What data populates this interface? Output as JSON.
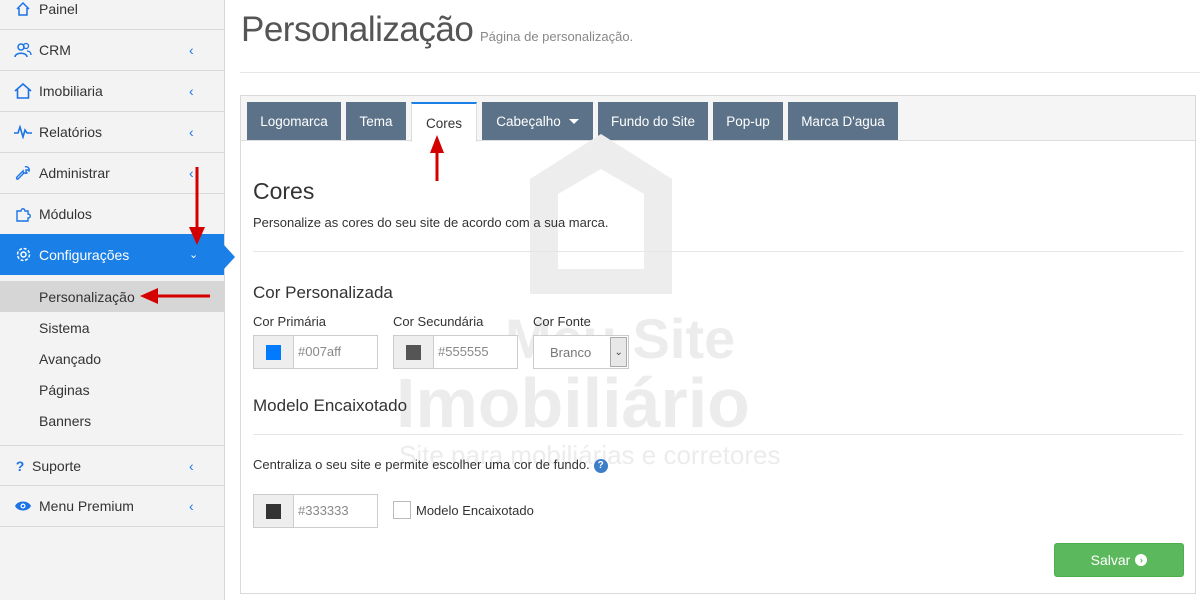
{
  "sidebar": {
    "items": [
      {
        "label": "Painel",
        "icon": "home-icon"
      },
      {
        "label": "CRM",
        "icon": "users-icon"
      },
      {
        "label": "Imobiliaria",
        "icon": "house-icon"
      },
      {
        "label": "Relatórios",
        "icon": "pulse-icon"
      },
      {
        "label": "Administrar",
        "icon": "wrench-icon"
      },
      {
        "label": "Módulos",
        "icon": "puzzle-icon"
      },
      {
        "label": "Configurações",
        "icon": "gear-icon"
      },
      {
        "label": "Suporte",
        "icon": "question-icon"
      },
      {
        "label": "Menu Premium",
        "icon": "eye-icon"
      }
    ],
    "subitems": [
      "Personalização",
      "Sistema",
      "Avançado",
      "Páginas",
      "Banners"
    ]
  },
  "header": {
    "title": "Personalização",
    "subtitle": "Página de personalização."
  },
  "tabs": [
    "Logomarca",
    "Tema",
    "Cores",
    "Cabeçalho",
    "Fundo do Site",
    "Pop-up",
    "Marca D'agua"
  ],
  "content": {
    "heading": "Cores",
    "description": "Personalize as cores do seu site de acordo com a sua marca.",
    "custom_color_heading": "Cor Personalizada",
    "primary_label": "Cor Primária",
    "primary_value": "#007aff",
    "secondary_label": "Cor Secundária",
    "secondary_value": "#555555",
    "font_label": "Cor Fonte",
    "font_value": "Branco",
    "boxed_heading": "Modelo Encaixotado",
    "boxed_description": "Centraliza o seu site e permite escolher uma cor de fundo.",
    "boxed_color_value": "#333333",
    "boxed_checkbox_label": "Modelo Encaixotado",
    "save_label": "Salvar"
  },
  "watermark": {
    "line1": "Meu Site",
    "line2": "Imobiliário",
    "line3": "Site para mobiliárias e corretores"
  },
  "colors": {
    "accent": "#1a7fe6",
    "tab": "#5b7289",
    "save": "#5cb85c",
    "primary_swatch": "#007aff",
    "secondary_swatch": "#555555",
    "boxed_swatch": "#333333"
  }
}
